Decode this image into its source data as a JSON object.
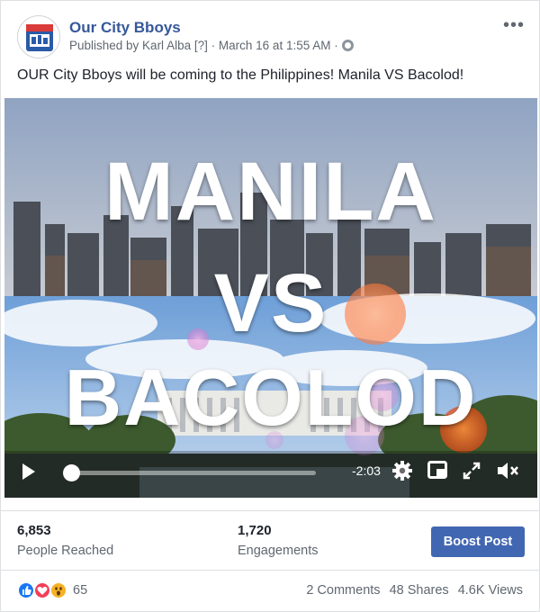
{
  "post": {
    "page_name": "Our City Bboys",
    "published_by": "Published by Karl Alba",
    "help_marker": "[?]",
    "separator": "·",
    "timestamp": "March 16 at 1:55 AM",
    "more_label": "•••",
    "text": "OUR City Bboys will be coming to the Philippines! Manila VS Bacolod!"
  },
  "video": {
    "title_lines": [
      "MANILA",
      "VS",
      "BACOLOD"
    ],
    "time_remaining": "-2:03",
    "progress_fraction": 0.03
  },
  "stats": {
    "reached_count": "6,853",
    "reached_label": "People Reached",
    "engagements_count": "1,720",
    "engagements_label": "Engagements",
    "boost_label": "Boost Post"
  },
  "footer": {
    "reaction_icons": [
      "like-icon",
      "love-icon",
      "wow-icon"
    ],
    "reaction_count": "65",
    "comments": "2 Comments",
    "shares": "48 Shares",
    "views": "4.6K Views"
  },
  "colors": {
    "link_blue": "#365899",
    "button_blue": "#4267b2",
    "like_blue": "#1877f2",
    "love_red": "#f33e58",
    "wow_yellow": "#f7b125"
  }
}
